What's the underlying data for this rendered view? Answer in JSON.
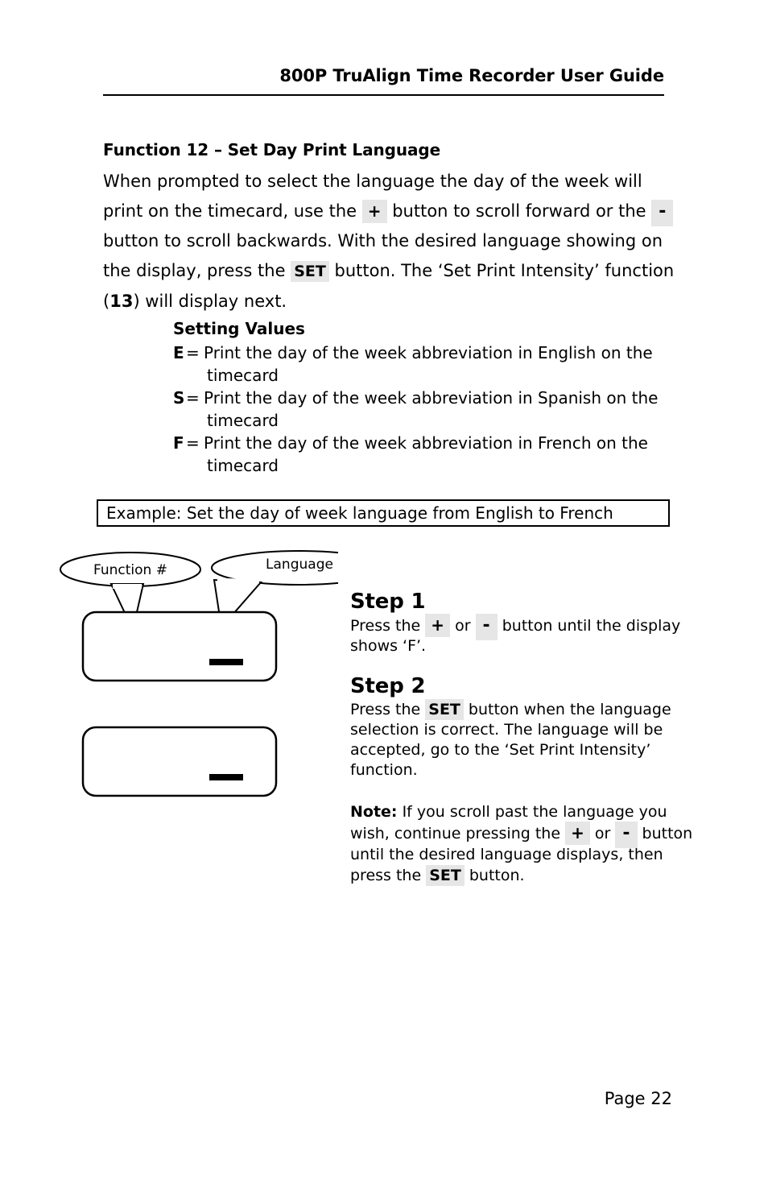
{
  "header": {
    "title": "800P TruAlign Time Recorder User Guide"
  },
  "section": {
    "heading": "Function 12 – Set Day Print Language",
    "intro": {
      "part1": "When prompted to select the language the day of the week will print on the timecard, use the ",
      "key_plus": "+",
      "part2": " button to scroll forward or the ",
      "key_minus": "-",
      "part3": " button to scroll backwards. With the desired language showing on the display, press the ",
      "key_set": "SET",
      "part4": " button. The ‘Set Print Intensity’ function (",
      "next_function_number": "13",
      "part5": ") will display next."
    }
  },
  "setting_values": {
    "title": "Setting Values",
    "rows": [
      {
        "code": "E",
        "eq": "=",
        "text": "Print the day of the week abbreviation in English on the timecard"
      },
      {
        "code": "S",
        "eq": "=",
        "text": "Print the day of the week abbreviation in Spanish on the timecard"
      },
      {
        "code": "F",
        "eq": "=",
        "text": "Print the day of the week abbreviation in French on the timecard"
      }
    ]
  },
  "example": {
    "text": "Example: Set the day of week language from English to French"
  },
  "diagram": {
    "callouts": [
      {
        "label": "Function #"
      },
      {
        "label": "Language"
      }
    ],
    "displays": [
      {
        "segment": "dash"
      },
      {
        "segment": "dash"
      }
    ]
  },
  "steps": [
    {
      "title": "Step 1",
      "body_part1": "Press the ",
      "key_plus": "+",
      "body_part2": " or ",
      "key_minus": "-",
      "body_part3": " button until the display shows ‘F’."
    },
    {
      "title": "Step 2",
      "body_part1": "Press the ",
      "key_set": "SET",
      "body_part2": " button when the language selection is correct. The language will be accepted, go to the ‘Set Print Intensity’ function."
    }
  ],
  "note": {
    "lead": "Note:",
    "part1": " If you scroll past the language you wish, continue pressing the ",
    "key_plus": "+",
    "part2": " or ",
    "key_minus": "-",
    "part3": " button until the desired language displays, then press the ",
    "key_set": "SET",
    "part4": " button."
  },
  "footer": {
    "page_label": "Page 22"
  },
  "colors": {
    "text": "#000000",
    "page_background": "#ffffff",
    "key_chip_background": "#e6e6e6",
    "rule": "#000000"
  }
}
